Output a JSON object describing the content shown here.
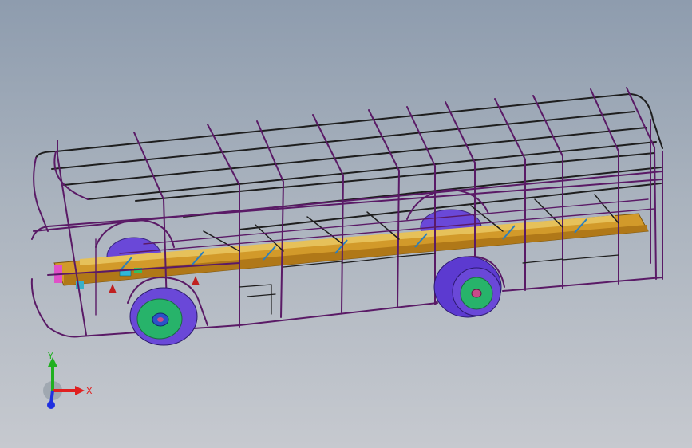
{
  "viewport": {
    "background_top": "#8e9cae",
    "background_bottom": "#c6c9cf"
  },
  "model": {
    "frame_color": "#5a1a66",
    "frame_shadow": "#1e1e1e",
    "chassis_color": "#d29a2a",
    "wheel_color": "#6a48d8",
    "hub_color": "#27b36a",
    "hub_center_color": "#2a52c8"
  },
  "triad": {
    "x_label": "X",
    "y_label": "Y",
    "x_color": "#e02020",
    "y_color": "#20b020",
    "z_color": "#2030e0",
    "icon": "coordinate-triad-icon"
  }
}
